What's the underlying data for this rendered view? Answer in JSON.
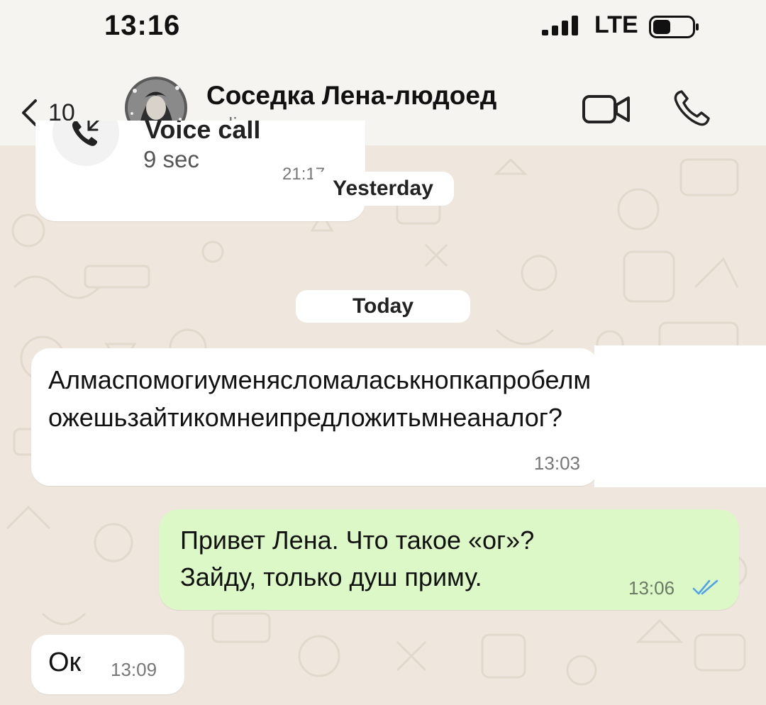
{
  "status_bar": {
    "time": "13:16",
    "network": "LTE",
    "icons": [
      "signal-bars-icon",
      "battery-icon"
    ]
  },
  "header": {
    "back_count": "10",
    "contact_name": "Соседка Лена-людоед",
    "status": "online",
    "icons": [
      "chevron-left-icon",
      "video-call-icon",
      "phone-icon"
    ]
  },
  "messages": {
    "call": {
      "title": "Voice call",
      "duration": "9 sec",
      "time": "21:17",
      "icon": "incoming-call-icon"
    },
    "date_yesterday": "Yesterday",
    "date_today": "Today",
    "incoming_1": {
      "text": "Алмаспомогиуменясломаласькнопкапробелможешьзайтикомнеипредложитьмнеаналог?",
      "time": "13:03"
    },
    "outgoing_1": {
      "line1": "Привет Лена. Что такое «ог»?",
      "line2": "Зайду, только душ приму.",
      "time": "13:06",
      "read_icon": "double-check-icon"
    },
    "incoming_2": {
      "text": "Ок",
      "time": "13:09"
    }
  },
  "colors": {
    "wallpaper": "#efe7dd",
    "incoming_bubble": "#ffffff",
    "outgoing_bubble": "#dcf8c6",
    "read_ticks": "#4fa3e6"
  }
}
